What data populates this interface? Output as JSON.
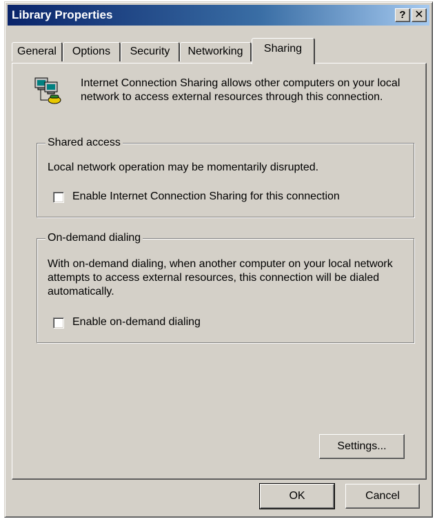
{
  "window": {
    "title": "Library Properties",
    "help_label": "?",
    "close_label": "✕"
  },
  "tabs": [
    {
      "label": "General",
      "active": false
    },
    {
      "label": "Options",
      "active": false
    },
    {
      "label": "Security",
      "active": false
    },
    {
      "label": "Networking",
      "active": false
    },
    {
      "label": "Sharing",
      "active": true
    }
  ],
  "intro": {
    "icon": "network-computers-icon",
    "text": "Internet Connection Sharing allows other computers on your local network to access external resources through this connection."
  },
  "shared_access": {
    "title": "Shared access",
    "note": "Local network operation may be momentarily disrupted.",
    "checkbox_label": "Enable Internet Connection Sharing for this connection",
    "checked": false
  },
  "on_demand": {
    "title": "On-demand dialing",
    "description": "With on-demand dialing, when another computer on your local network attempts to access external resources, this connection will be dialed automatically.",
    "checkbox_label": "Enable on-demand dialing",
    "checked": false
  },
  "buttons": {
    "settings": "Settings...",
    "ok": "OK",
    "cancel": "Cancel"
  },
  "colors": {
    "titlebar_start": "#0a246a",
    "titlebar_end": "#a6caf0",
    "face": "#d4d0c8"
  }
}
